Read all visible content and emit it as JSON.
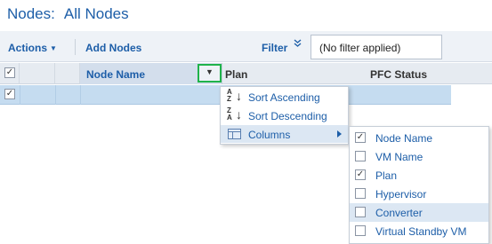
{
  "page": {
    "title_prefix": "Nodes:",
    "title_suffix": "All Nodes"
  },
  "toolbar": {
    "actions_label": "Actions",
    "add_nodes_label": "Add Nodes",
    "filter_label": "Filter",
    "filter_icon": "double-chevron-down-icon",
    "filter_value": "(No filter applied)"
  },
  "grid": {
    "columns": [
      "Node Name",
      "Plan",
      "PFC Status"
    ],
    "header_checkbox_checked": true,
    "row_checkbox_checked": true,
    "sort_button_icon": "dropdown-triangle-icon"
  },
  "column_menu": {
    "items": [
      {
        "label": "Sort Ascending",
        "icon": "sort-ascending-icon",
        "glyph_top": "A",
        "glyph_bottom": "Z"
      },
      {
        "label": "Sort Descending",
        "icon": "sort-descending-icon",
        "glyph_top": "Z",
        "glyph_bottom": "A"
      },
      {
        "label": "Columns",
        "icon": "columns-icon",
        "has_submenu": true
      }
    ]
  },
  "columns_submenu": {
    "items": [
      {
        "label": "Node Name",
        "checked": true
      },
      {
        "label": "VM Name",
        "checked": false
      },
      {
        "label": "Plan",
        "checked": true
      },
      {
        "label": "Hypervisor",
        "checked": false
      },
      {
        "label": "Converter",
        "checked": false
      },
      {
        "label": "Virtual Standby VM",
        "checked": false
      }
    ]
  },
  "colors": {
    "link": "#1d5ea8",
    "selected_row": "#c5dcf0",
    "highlight_border": "#1fb34a"
  }
}
